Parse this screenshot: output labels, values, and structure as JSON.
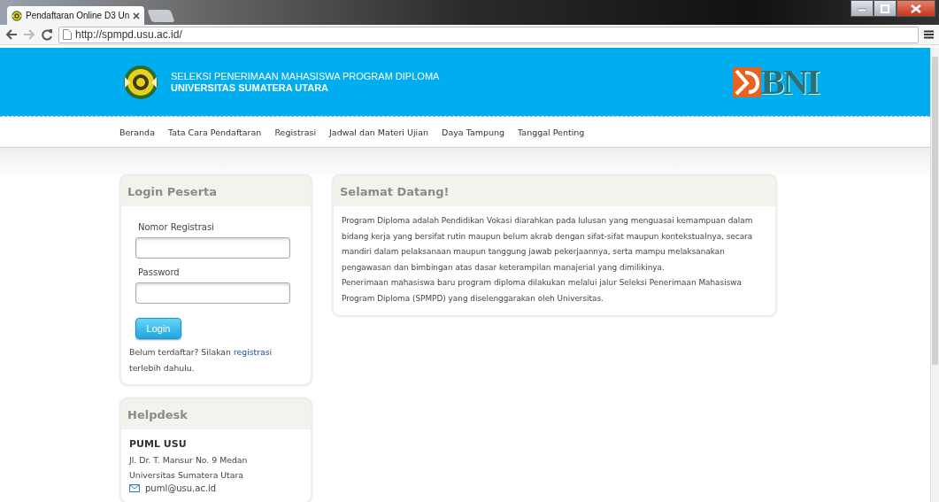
{
  "browser": {
    "tab_title": "Pendaftaran Online D3 Un",
    "url": "http://spmpd.usu.ac.id/"
  },
  "header": {
    "title_lines": [
      "SELEKSI PENERIMAAN MAHASISWA PROGRAM DIPLOMA",
      "UNIVERSITAS SUMATERA UTARA"
    ],
    "partner_logo": "BNI"
  },
  "nav": [
    "Beranda",
    "Tata Cara Pendaftaran",
    "Registrasi",
    "Jadwal dan Materi Ujian",
    "Daya Tampung",
    "Tanggal Penting"
  ],
  "login": {
    "title": "Login Peserta",
    "fields": [
      {
        "label": "Nomor Registrasi"
      },
      {
        "label": "Password"
      }
    ],
    "button": "Login",
    "note_before": "Belum terdaftar? Silakan ",
    "note_link": "registrasi",
    "note_after": " terlebih dahulu."
  },
  "welcome": {
    "title": "Selamat Datang!",
    "paragraphs": [
      "Program Diploma adalah Pendidikan Vokasi diarahkan pada lulusan yang menguasai kemampuan dalam bidang kerja yang bersifat rutin maupun belum akrab dengan sifat-sifat maupun kontekstualnya, secara mandiri dalam pelaksanaan maupun tanggung jawab pekerjaannya, serta mampu melaksanakan pengawasan dan bimbingan atas dasar keterampilan manajerial yang dimilikinya.",
      "Penerimaan mahasiswa baru program diploma dilakukan melalui jalur Seleksi Penerimaan Mahasiswa Program Diploma (SPMPD) yang diselenggarakan oleh Universitas."
    ]
  },
  "helpdesk": {
    "title": "Helpdesk",
    "org": "PUML USU",
    "address_lines": [
      "Jl. Dr. T. Mansur No. 9 Medan",
      "Universitas Sumatera Utara"
    ],
    "email": "puml@usu.ac.id"
  }
}
